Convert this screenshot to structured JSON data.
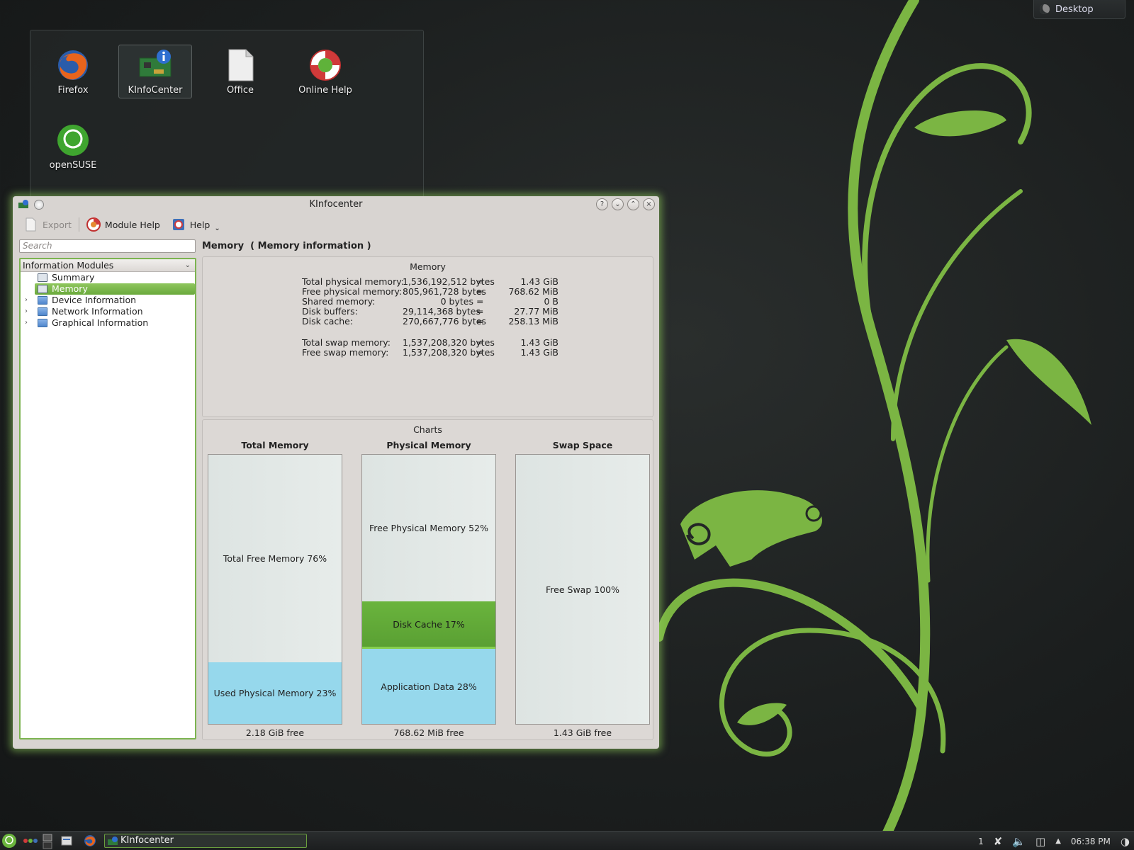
{
  "desktop": {
    "button_label": "Desktop",
    "icons": [
      {
        "label": "Firefox",
        "icon": "firefox-icon"
      },
      {
        "label": "KInfoCenter",
        "icon": "kinfocenter-icon"
      },
      {
        "label": "Office",
        "icon": "document-icon"
      },
      {
        "label": "Online Help",
        "icon": "lifebuoy-icon"
      },
      {
        "label": "openSUSE",
        "icon": "opensuse-icon"
      }
    ]
  },
  "window": {
    "title": "KInfocenter",
    "toolbar": {
      "export_label": "Export",
      "module_help_label": "Module Help",
      "help_label": "Help"
    },
    "search_placeholder": "Search",
    "module_title": "Memory  ( Memory information )",
    "tree": {
      "header": "Information Modules",
      "items": [
        {
          "label": "Summary",
          "expandable": false
        },
        {
          "label": "Memory",
          "expandable": false,
          "selected": true
        },
        {
          "label": "Device Information",
          "expandable": true
        },
        {
          "label": "Network Information",
          "expandable": true
        },
        {
          "label": "Graphical Information",
          "expandable": true
        }
      ]
    },
    "memory": {
      "title": "Memory",
      "rows": [
        {
          "key": "Total physical memory:",
          "bytes": "1,536,192,512 bytes",
          "value": "1.43 GiB"
        },
        {
          "key": "Free physical memory:",
          "bytes": "805,961,728 bytes",
          "value": "768.62 MiB"
        },
        {
          "key": "Shared memory:",
          "bytes": "0 bytes",
          "value": "0 B"
        },
        {
          "key": "Disk buffers:",
          "bytes": "29,114,368 bytes",
          "value": "27.77 MiB"
        },
        {
          "key": "Disk cache:",
          "bytes": "270,667,776 bytes",
          "value": "258.13 MiB"
        }
      ],
      "swap_rows": [
        {
          "key": "Total swap memory:",
          "bytes": "1,537,208,320 bytes",
          "value": "1.43 GiB"
        },
        {
          "key": "Free swap memory:",
          "bytes": "1,537,208,320 bytes",
          "value": "1.43 GiB"
        }
      ],
      "equals": "="
    },
    "charts": {
      "title": "Charts",
      "columns": [
        {
          "title": "Total Memory",
          "footer": "2.18 GiB free",
          "segments": [
            {
              "label": "Total Free Memory 76%",
              "kind": "free",
              "fraction": 0.77
            },
            {
              "label": "Used Physical Memory 23%",
              "kind": "used",
              "fraction": 0.23
            }
          ]
        },
        {
          "title": "Physical Memory",
          "footer": "768.62 MiB free",
          "segments": [
            {
              "label": "Free Physical Memory 52%",
              "kind": "free",
              "fraction": 0.545
            },
            {
              "label": "Disk Cache 17%",
              "kind": "cache",
              "fraction": 0.175
            },
            {
              "label": "Application Data 28%",
              "kind": "used",
              "fraction": 0.28
            }
          ]
        },
        {
          "title": "Swap Space",
          "footer": "1.43 GiB free",
          "segments": [
            {
              "label": "Free Swap 100%",
              "kind": "free",
              "fraction": 1.0
            }
          ]
        }
      ]
    }
  },
  "taskbar": {
    "task_label": "KInfocenter",
    "desktop_number": "1",
    "clock": "06:38 PM"
  },
  "colors": {
    "accent_green": "#7cb450",
    "used_blue": "#96d8ec",
    "cache_green": "#6ab43d"
  }
}
